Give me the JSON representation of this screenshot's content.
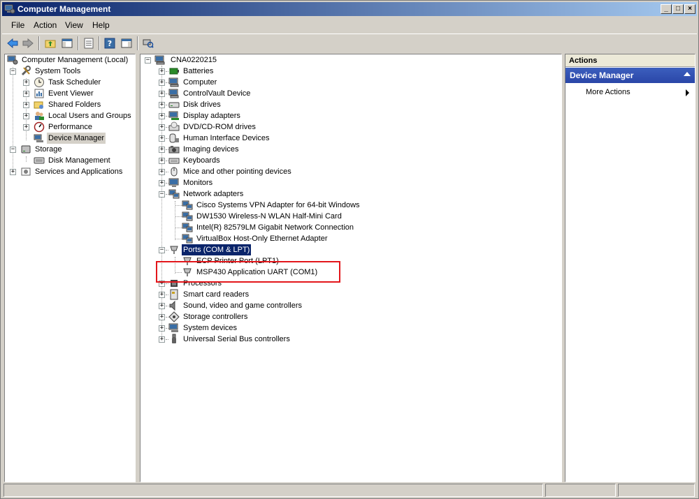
{
  "window": {
    "title": "Computer Management"
  },
  "menu": {
    "file": "File",
    "action": "Action",
    "view": "View",
    "help": "Help"
  },
  "left_tree": {
    "root": "Computer Management (Local)",
    "system_tools": "System Tools",
    "task_scheduler": "Task Scheduler",
    "event_viewer": "Event Viewer",
    "shared_folders": "Shared Folders",
    "local_users": "Local Users and Groups",
    "performance": "Performance",
    "device_manager": "Device Manager",
    "storage": "Storage",
    "disk_management": "Disk Management",
    "services": "Services and Applications"
  },
  "device_tree": {
    "computer_name": "CNA0220215",
    "categories": [
      "Batteries",
      "Computer",
      "ControlVault Device",
      "Disk drives",
      "Display adapters",
      "DVD/CD-ROM drives",
      "Human Interface Devices",
      "Imaging devices",
      "Keyboards",
      "Mice and other pointing devices",
      "Monitors",
      "Network adapters",
      "Ports (COM & LPT)",
      "Processors",
      "Smart card readers",
      "Sound, video and game controllers",
      "Storage controllers",
      "System devices",
      "Universal Serial Bus controllers"
    ],
    "network_children": [
      "Cisco Systems VPN Adapter for 64-bit Windows",
      "DW1530 Wireless-N WLAN Half-Mini Card",
      "Intel(R) 82579LM Gigabit Network Connection",
      "VirtualBox Host-Only Ethernet Adapter"
    ],
    "ports_children": [
      "ECP Printer Port (LPT1)",
      "MSP430 Application UART (COM1)"
    ]
  },
  "actions": {
    "header": "Actions",
    "section": "Device Manager",
    "more": "More Actions"
  },
  "colors": {
    "highlight_box": "#e3161b",
    "selection": "#0a246a"
  }
}
